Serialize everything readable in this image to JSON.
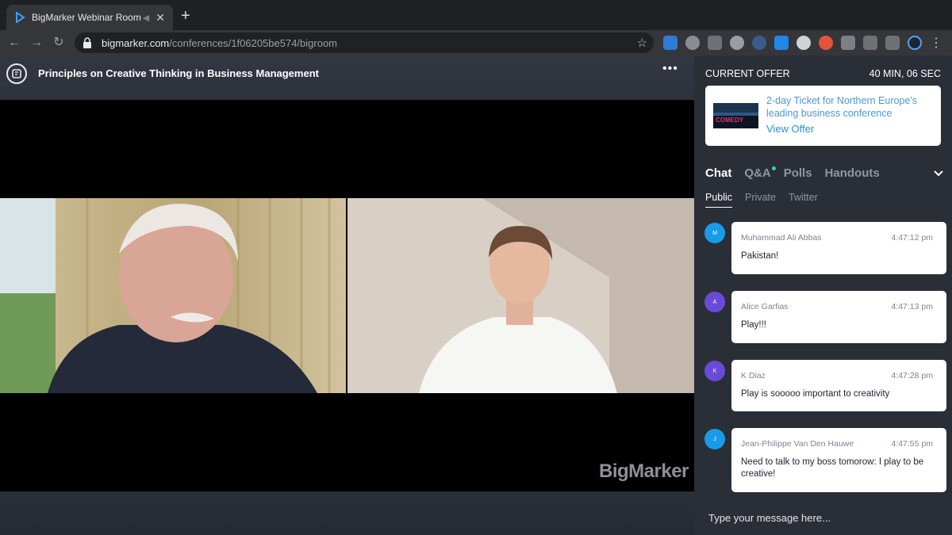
{
  "browser": {
    "tab_title": "BigMarker Webinar Room",
    "url_host": "bigmarker.com",
    "url_path": "/conferences/1f06205be574/bigroom"
  },
  "header": {
    "title": "Principles on Creative Thinking in Business Management"
  },
  "stage": {
    "watermark": "BigMarker"
  },
  "offer": {
    "label": "CURRENT OFFER",
    "timer": "40 MIN, 06 SEC",
    "description": "2-day Ticket for Northern Europe's leading business conference",
    "link": "View Offer",
    "thumb_text": "COMEDY"
  },
  "panel": {
    "tabs": [
      "Chat",
      "Q&A",
      "Polls",
      "Handouts"
    ],
    "subtabs": [
      "Public",
      "Private",
      "Twitter"
    ]
  },
  "chat": {
    "messages": [
      {
        "initial": "M",
        "name": "Muhammad Ali Abbas",
        "time": "4:47:12 pm",
        "text": "Pakistan!",
        "avatar_color": "#1a9be8"
      },
      {
        "initial": "A",
        "name": "Alice Garfias",
        "time": "4:47:13 pm",
        "text": "Play!!!",
        "avatar_color": "#6a4bd8"
      },
      {
        "initial": "K",
        "name": "K Diaz",
        "time": "4:47:28 pm",
        "text": "Play is sooooo important to creativity",
        "avatar_color": "#6a4bd8"
      },
      {
        "initial": "J",
        "name": "Jean-Philippe Van Den Hauwe",
        "time": "4:47:55 pm",
        "text": "Need to talk to my boss tomorow: I play to be creative!",
        "avatar_color": "#1a9be8"
      }
    ],
    "placeholder": "Type your message here..."
  },
  "colors": {
    "accent": "#2a8fd8",
    "panel_bg": "#2a2e37",
    "qa_indicator": "#2fd5a8"
  }
}
